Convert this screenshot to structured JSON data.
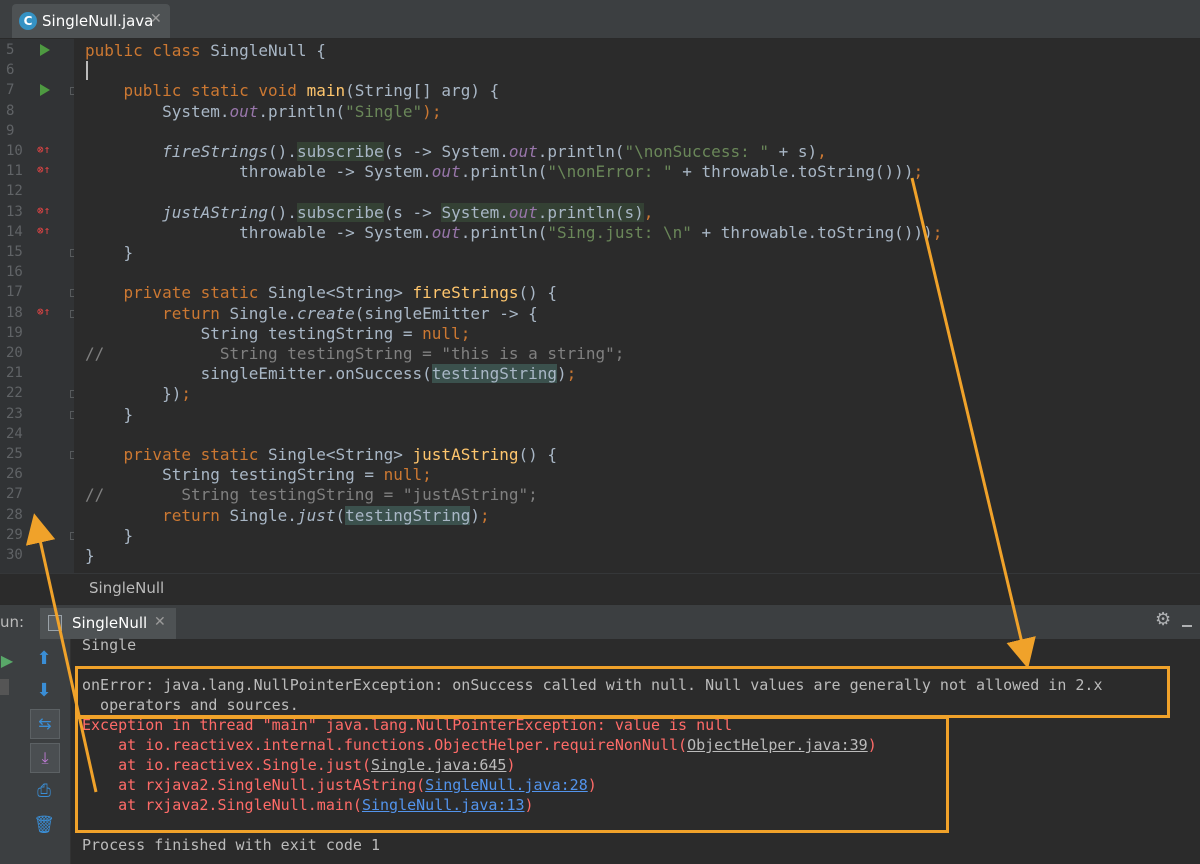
{
  "tab": {
    "filename": "SingleNull.java",
    "icon": "java-class-icon"
  },
  "breadcrumb": "SingleNull",
  "run_panel": {
    "label": "un:",
    "tab_name": "SingleNull"
  },
  "colors": {
    "keyword": "#cc7832",
    "string": "#6a8759",
    "method": "#ffc66d",
    "error": "#ff6b68",
    "link": "#5394ec",
    "annotation": "#f0a22a"
  },
  "console": {
    "out1": "Single",
    "onerror1": "onError: java.lang.NullPointerException: onSuccess called with null. Null values are generally not allowed in 2.x",
    "onerror2": "  operators and sources.",
    "exc": "Exception in thread \"main\" java.lang.NullPointerException: value is null",
    "st1_pre": "    at io.reactivex.internal.functions.ObjectHelper.requireNonNull(",
    "st1_link": "ObjectHelper.java:39",
    "st2_pre": "    at io.reactivex.Single.just(",
    "st2_link": "Single.java:645",
    "st3_pre": "    at rxjava2.SingleNull.justAString(",
    "st3_link": "SingleNull.java:28",
    "st4_pre": "    at rxjava2.SingleNull.main(",
    "st4_link": "SingleNull.java:13",
    "close_paren": ")",
    "exit": "Process finished with exit code 1"
  },
  "code_lines": [
    {
      "n": "5",
      "t": [
        [
          "kw",
          "public class "
        ],
        [
          "",
          "SingleNull {"
        ]
      ]
    },
    {
      "n": "6",
      "t": []
    },
    {
      "n": "7",
      "t": [
        [
          "",
          "    "
        ],
        [
          "kw",
          "public static void "
        ],
        [
          "fn",
          "main"
        ],
        [
          "",
          "(String[] arg) {"
        ]
      ]
    },
    {
      "n": "8",
      "t": [
        [
          "",
          "        System."
        ],
        [
          "st",
          "out"
        ],
        [
          "",
          ".println("
        ],
        [
          "str",
          "\"Single\""
        ],
        [
          "kw",
          ")"
        ],
        [
          "kw",
          ";"
        ]
      ]
    },
    {
      "n": "9",
      "t": []
    },
    {
      "n": "10",
      "t": [
        [
          "",
          "        "
        ],
        [
          "it",
          "fireStrings"
        ],
        [
          "",
          "()."
        ],
        [
          "hl",
          "subscribe"
        ],
        [
          "",
          "(s -> System."
        ],
        [
          "st",
          "out"
        ],
        [
          "",
          ".println("
        ],
        [
          "str",
          "\"\\nonSuccess: \""
        ],
        [
          "",
          " + s)"
        ],
        [
          "kw",
          ","
        ]
      ]
    },
    {
      "n": "11",
      "t": [
        [
          "",
          "                throwable -> System."
        ],
        [
          "st",
          "out"
        ],
        [
          "",
          ".println("
        ],
        [
          "str",
          "\"\\nonError: \""
        ],
        [
          "",
          " + throwable.toString()))"
        ],
        [
          "kw",
          ";"
        ]
      ]
    },
    {
      "n": "12",
      "t": []
    },
    {
      "n": "13",
      "t": [
        [
          "",
          "        "
        ],
        [
          "it",
          "justAString"
        ],
        [
          "",
          "()."
        ],
        [
          "hl",
          "subscribe"
        ],
        [
          "",
          "(s -> "
        ],
        [
          "hl",
          "System."
        ],
        [
          "hlst",
          "out"
        ],
        [
          "hl",
          ".println(s)"
        ],
        [
          "kw",
          ","
        ]
      ]
    },
    {
      "n": "14",
      "t": [
        [
          "",
          "                throwable -> System."
        ],
        [
          "st",
          "out"
        ],
        [
          "",
          ".println("
        ],
        [
          "str",
          "\"Sing.just: \\n\""
        ],
        [
          "",
          " + throwable.toString()))"
        ],
        [
          "kw",
          ";"
        ]
      ]
    },
    {
      "n": "15",
      "t": [
        [
          "",
          "    }"
        ]
      ]
    },
    {
      "n": "16",
      "t": []
    },
    {
      "n": "17",
      "t": [
        [
          "",
          "    "
        ],
        [
          "kw",
          "private static "
        ],
        [
          "",
          "Single<String> "
        ],
        [
          "fn",
          "fireStrings"
        ],
        [
          "",
          "() {"
        ]
      ]
    },
    {
      "n": "18",
      "t": [
        [
          "",
          "        "
        ],
        [
          "kw",
          "return "
        ],
        [
          "",
          "Single."
        ],
        [
          "it",
          "create"
        ],
        [
          "",
          "(singleEmitter -> {"
        ]
      ]
    },
    {
      "n": "19",
      "t": [
        [
          "",
          "            String testingString = "
        ],
        [
          "kw",
          "null;"
        ]
      ]
    },
    {
      "n": "20",
      "t": [
        [
          "cm",
          "//            String testingString = \"this is a string\";"
        ]
      ]
    },
    {
      "n": "21",
      "t": [
        [
          "",
          "            singleEmitter.onSuccess("
        ],
        [
          "hl2",
          "testingString"
        ],
        [
          "",
          ")"
        ],
        [
          "kw",
          ";"
        ]
      ]
    },
    {
      "n": "22",
      "t": [
        [
          "",
          "        })"
        ],
        [
          "kw",
          ";"
        ]
      ]
    },
    {
      "n": "23",
      "t": [
        [
          "",
          "    }"
        ]
      ]
    },
    {
      "n": "24",
      "t": []
    },
    {
      "n": "25",
      "t": [
        [
          "",
          "    "
        ],
        [
          "kw",
          "private static "
        ],
        [
          "",
          "Single<String> "
        ],
        [
          "fn",
          "justAString"
        ],
        [
          "",
          "() {"
        ]
      ]
    },
    {
      "n": "26",
      "t": [
        [
          "",
          "        String testingString = "
        ],
        [
          "kw",
          "null;"
        ]
      ]
    },
    {
      "n": "27",
      "t": [
        [
          "cm",
          "//        String testingString = \"justAString\";"
        ]
      ]
    },
    {
      "n": "28",
      "t": [
        [
          "",
          "        "
        ],
        [
          "kw",
          "return "
        ],
        [
          "",
          "Single."
        ],
        [
          "it",
          "just"
        ],
        [
          "",
          "("
        ],
        [
          "hl2",
          "testingString"
        ],
        [
          "",
          ")"
        ],
        [
          "kw",
          ";"
        ]
      ]
    },
    {
      "n": "29",
      "t": [
        [
          "",
          "    }"
        ]
      ]
    },
    {
      "n": "30",
      "t": [
        [
          "",
          "}"
        ]
      ]
    }
  ]
}
